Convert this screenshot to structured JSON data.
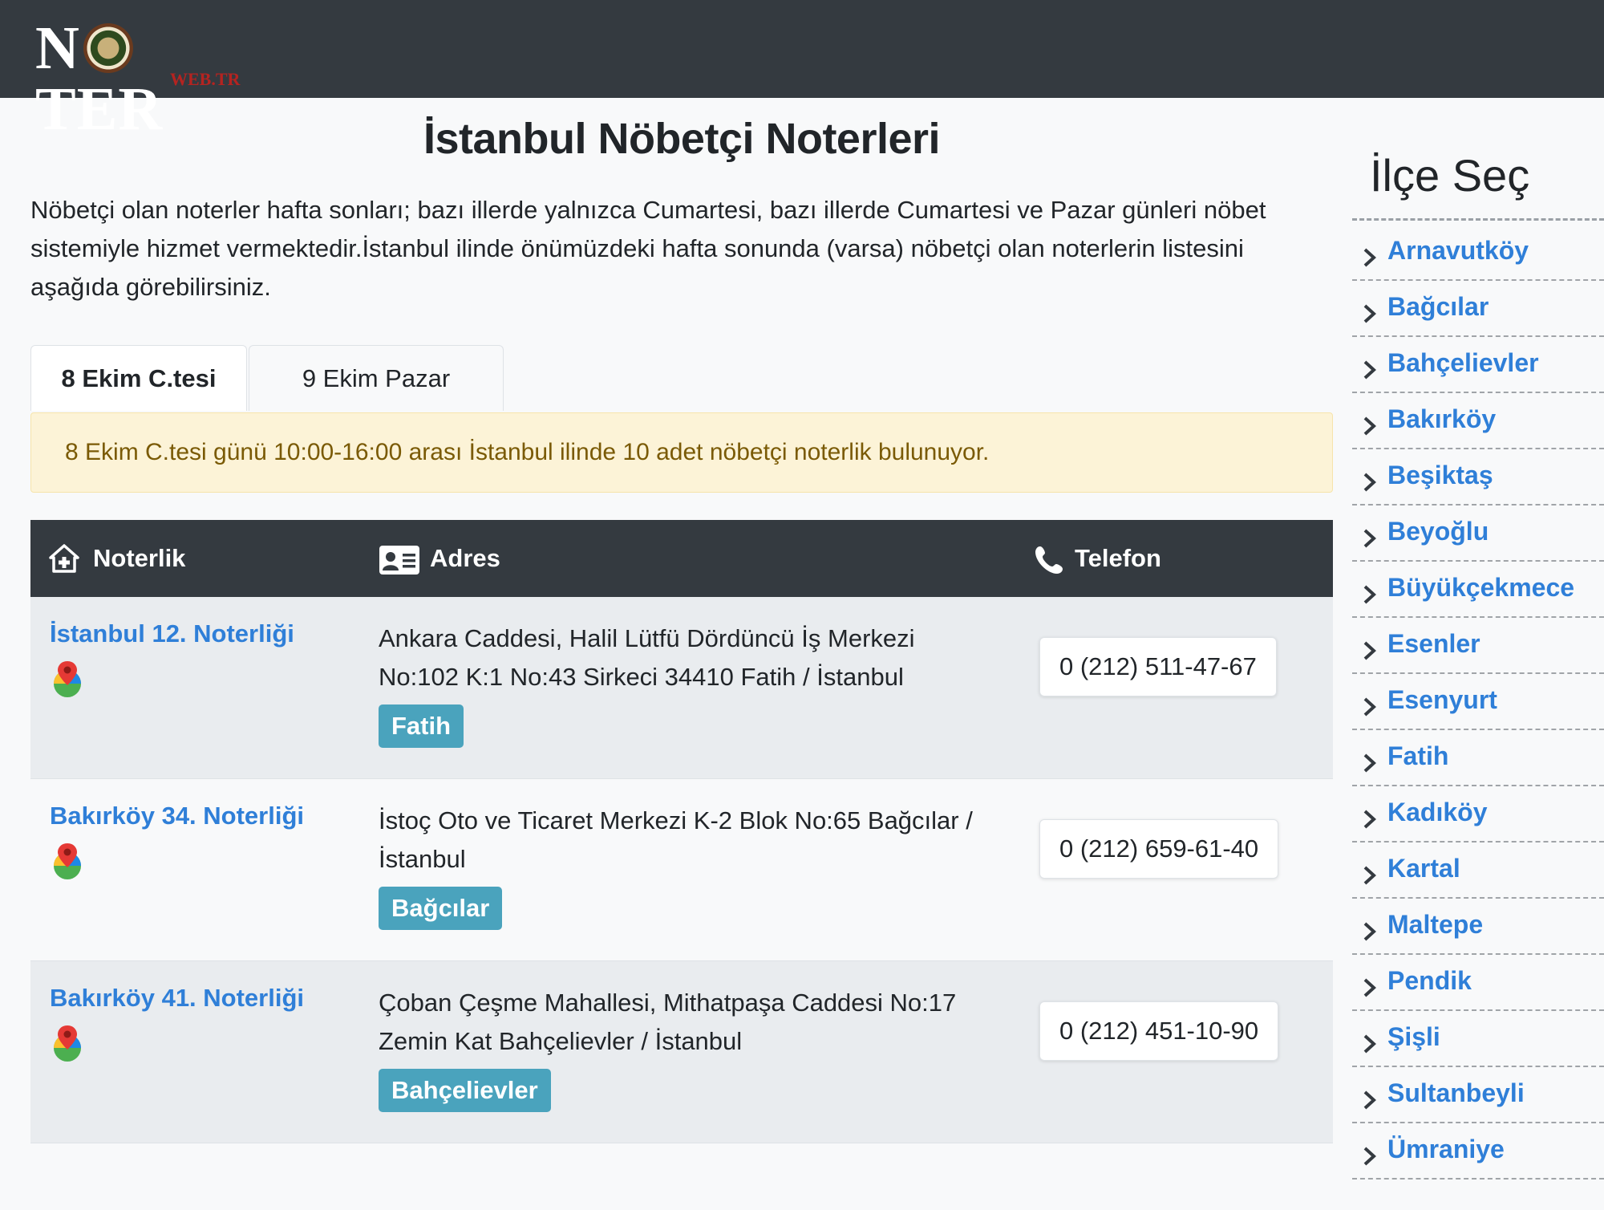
{
  "header": {
    "logo_main_left": "N",
    "logo_main_right": "TER",
    "logo_sub": "WEB.TR"
  },
  "page": {
    "title": "İstanbul Nöbetçi Noterleri",
    "intro": "Nöbetçi olan noterler hafta sonları; bazı illerde yalnızca Cumartesi, bazı illerde Cumartesi ve Pazar günleri nöbet sistemiyle hizmet vermektedir.İstanbul ilinde önümüzdeki hafta sonunda (varsa) nöbetçi olan noterlerin listesini aşağıda görebilirsiniz."
  },
  "tabs": [
    {
      "label": "8 Ekim C.tesi",
      "active": true
    },
    {
      "label": "9 Ekim Pazar",
      "active": false
    }
  ],
  "alert": {
    "text": "8 Ekim C.tesi günü 10:00-16:00 arası İstanbul ilinde 10 adet nöbetçi noterlik bulunuyor."
  },
  "table": {
    "headers": {
      "name": "Noterlik",
      "address": "Adres",
      "phone": "Telefon"
    },
    "rows": [
      {
        "name": "İstanbul 12. Noterliği",
        "address": "Ankara Caddesi, Halil Lütfü Dördüncü İş Merkezi No:102 K:1 No:43 Sirkeci 34410 Fatih / İstanbul",
        "district": "Fatih",
        "phone": "0 (212) 511-47-67"
      },
      {
        "name": "Bakırköy 34. Noterliği",
        "address": "İstoç Oto ve Ticaret Merkezi K-2 Blok No:65 Bağcılar / İstanbul",
        "district": "Bağcılar",
        "phone": "0 (212) 659-61-40"
      },
      {
        "name": "Bakırköy 41. Noterliği",
        "address": "Çoban Çeşme Mahallesi, Mithatpaşa Caddesi No:17 Zemin Kat Bahçelievler / İstanbul",
        "district": "Bahçelievler",
        "phone": "0 (212) 451-10-90"
      }
    ]
  },
  "sidebar": {
    "title": "İlçe Seç",
    "items": [
      "Arnavutköy",
      "Bağcılar",
      "Bahçelievler",
      "Bakırköy",
      "Beşiktaş",
      "Beyoğlu",
      "Büyükçekmece",
      "Esenler",
      "Esenyurt",
      "Fatih",
      "Kadıköy",
      "Kartal",
      "Maltepe",
      "Pendik",
      "Şişli",
      "Sultanbeyli",
      "Ümraniye"
    ]
  },
  "icons": {
    "row_map": "google-maps-pin-icon",
    "header_name": "home-plus-icon",
    "header_address": "id-card-icon",
    "header_phone": "phone-icon",
    "sidebar_item": "chevron-right-icon"
  },
  "colors": {
    "topbar": "#343a40",
    "link": "#2f7fd8",
    "badge": "#4aa3bd",
    "alert_bg": "#fcf3d7",
    "alert_text": "#7a5a05"
  }
}
